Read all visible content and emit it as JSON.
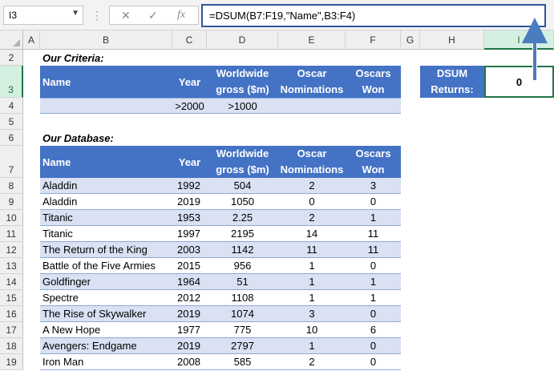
{
  "name_box": "I3",
  "formula_icons": {
    "cancel": "✕",
    "enter": "✓",
    "fx": "fx"
  },
  "formula": "=DSUM(B7:F19,\"Name\",B3:F4)",
  "columns": [
    "A",
    "B",
    "C",
    "D",
    "E",
    "F",
    "G",
    "H",
    "I"
  ],
  "rows": [
    "2",
    "3",
    "4",
    "5",
    "6",
    "7",
    "8",
    "9",
    "10",
    "11",
    "12",
    "13",
    "14",
    "15",
    "16",
    "17",
    "18",
    "19"
  ],
  "criteria": {
    "title": "Our Criteria:",
    "headers": [
      "Name",
      "Year",
      "Worldwide gross ($m)",
      "Oscar Nominations",
      "Oscars Won"
    ],
    "values": [
      "",
      ">2000",
      ">1000",
      "",
      ""
    ]
  },
  "database": {
    "title": "Our Database:",
    "headers": [
      "Name",
      "Year",
      "Worldwide gross ($m)",
      "Oscar Nominations",
      "Oscars Won"
    ],
    "rows": [
      [
        "Aladdin",
        "1992",
        "504",
        "2",
        "3"
      ],
      [
        "Aladdin",
        "2019",
        "1050",
        "0",
        "0"
      ],
      [
        "Titanic",
        "1953",
        "2.25",
        "2",
        "1"
      ],
      [
        "Titanic",
        "1997",
        "2195",
        "14",
        "11"
      ],
      [
        "The Return of the King",
        "2003",
        "1142",
        "11",
        "11"
      ],
      [
        "Battle of the Five Armies",
        "2015",
        "956",
        "1",
        "0"
      ],
      [
        "Goldfinger",
        "1964",
        "51",
        "1",
        "1"
      ],
      [
        "Spectre",
        "2012",
        "1108",
        "1",
        "1"
      ],
      [
        "The Rise of Skywalker",
        "2019",
        "1074",
        "3",
        "0"
      ],
      [
        "A New Hope",
        "1977",
        "775",
        "10",
        "6"
      ],
      [
        "Avengers: Endgame",
        "2019",
        "2797",
        "1",
        "0"
      ],
      [
        "Iron Man",
        "2008",
        "585",
        "2",
        "0"
      ]
    ]
  },
  "result": {
    "label": "DSUM Returns:",
    "value": "0"
  },
  "colors": {
    "header_blue": "#4472c4",
    "band_light": "#d9e1f2",
    "arrow": "#4a7cc0",
    "selection": "#217346"
  }
}
